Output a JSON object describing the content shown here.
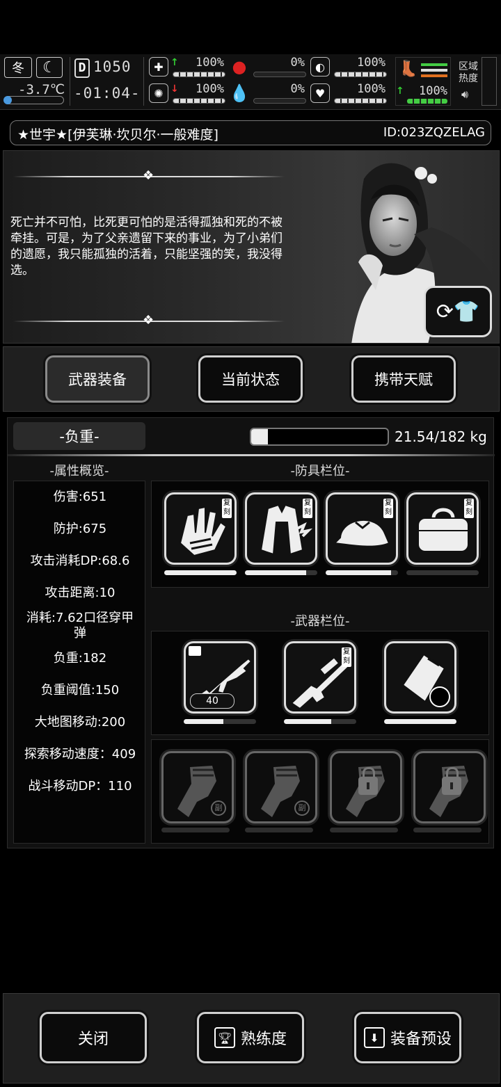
{
  "hud": {
    "season": "冬",
    "temperature": "-3.7℃",
    "day": "D",
    "money": "1050",
    "clock": "-01:04-",
    "stats": {
      "health": {
        "arrow": "↑",
        "value": "100%"
      },
      "mind": {
        "arrow": "↓",
        "value": "100%"
      },
      "hunger": {
        "value": "0%"
      },
      "thirst": {
        "value": "0%"
      },
      "stamina": {
        "value": "100%"
      },
      "mood": {
        "value": "100%"
      },
      "speed": {
        "arrow": "↑",
        "value": "100%"
      }
    },
    "region_label": "区域热度"
  },
  "title": {
    "text": "★世宇★[伊芙琳·坎贝尔·一般难度]",
    "id": "ID:023ZQZELAG"
  },
  "character": {
    "quote": "死亡并不可怕，比死更可怕的是活得孤独和死的不被牵挂。可是，为了父亲遗留下来的事业，为了小弟们的遗愿，我只能孤独的活着，只能坚强的笑，我没得选。"
  },
  "tabs": [
    {
      "label": "武器装备",
      "active": true
    },
    {
      "label": "当前状态",
      "active": false
    },
    {
      "label": "携带天赋",
      "active": false
    }
  ],
  "weight": {
    "label": "-负重-",
    "text": "21.54/182 kg",
    "fraction": 0.12
  },
  "attributes": {
    "header": "-属性概览-",
    "items": [
      "伤害:651",
      "防护:675",
      "攻击消耗DP:68.6",
      "攻击距离:10",
      "消耗:7.62口径穿甲弹",
      "负重:182",
      "负重阈值:150",
      "大地图移动:200",
      "探索移动速度：409",
      "战斗移动DP：110"
    ]
  },
  "armor": {
    "header": "-防具栏位-",
    "slots": [
      {
        "name": "gloves",
        "tag": "复刻",
        "durability": 1.0
      },
      {
        "name": "coat",
        "tag": "复刻",
        "durability": 0.85
      },
      {
        "name": "cap",
        "tag": "复刻",
        "durability": 0.9
      },
      {
        "name": "bag",
        "tag": "复刻",
        "durability": 0
      }
    ]
  },
  "weapons": {
    "header": "-武器栏位-",
    "slots": [
      {
        "name": "rifle",
        "count": "40",
        "durability": 0.55
      },
      {
        "name": "sniper",
        "tag": "复刻",
        "durability": 0.65
      },
      {
        "name": "armor-plate",
        "durability": 1.0
      }
    ],
    "sub_slots": [
      {
        "badge": "副",
        "locked": false
      },
      {
        "badge": "副",
        "locked": false
      },
      {
        "locked": true
      },
      {
        "locked": true
      }
    ]
  },
  "bottom": {
    "close": "关闭",
    "proficiency": "熟练度",
    "preset": "装备预设"
  }
}
